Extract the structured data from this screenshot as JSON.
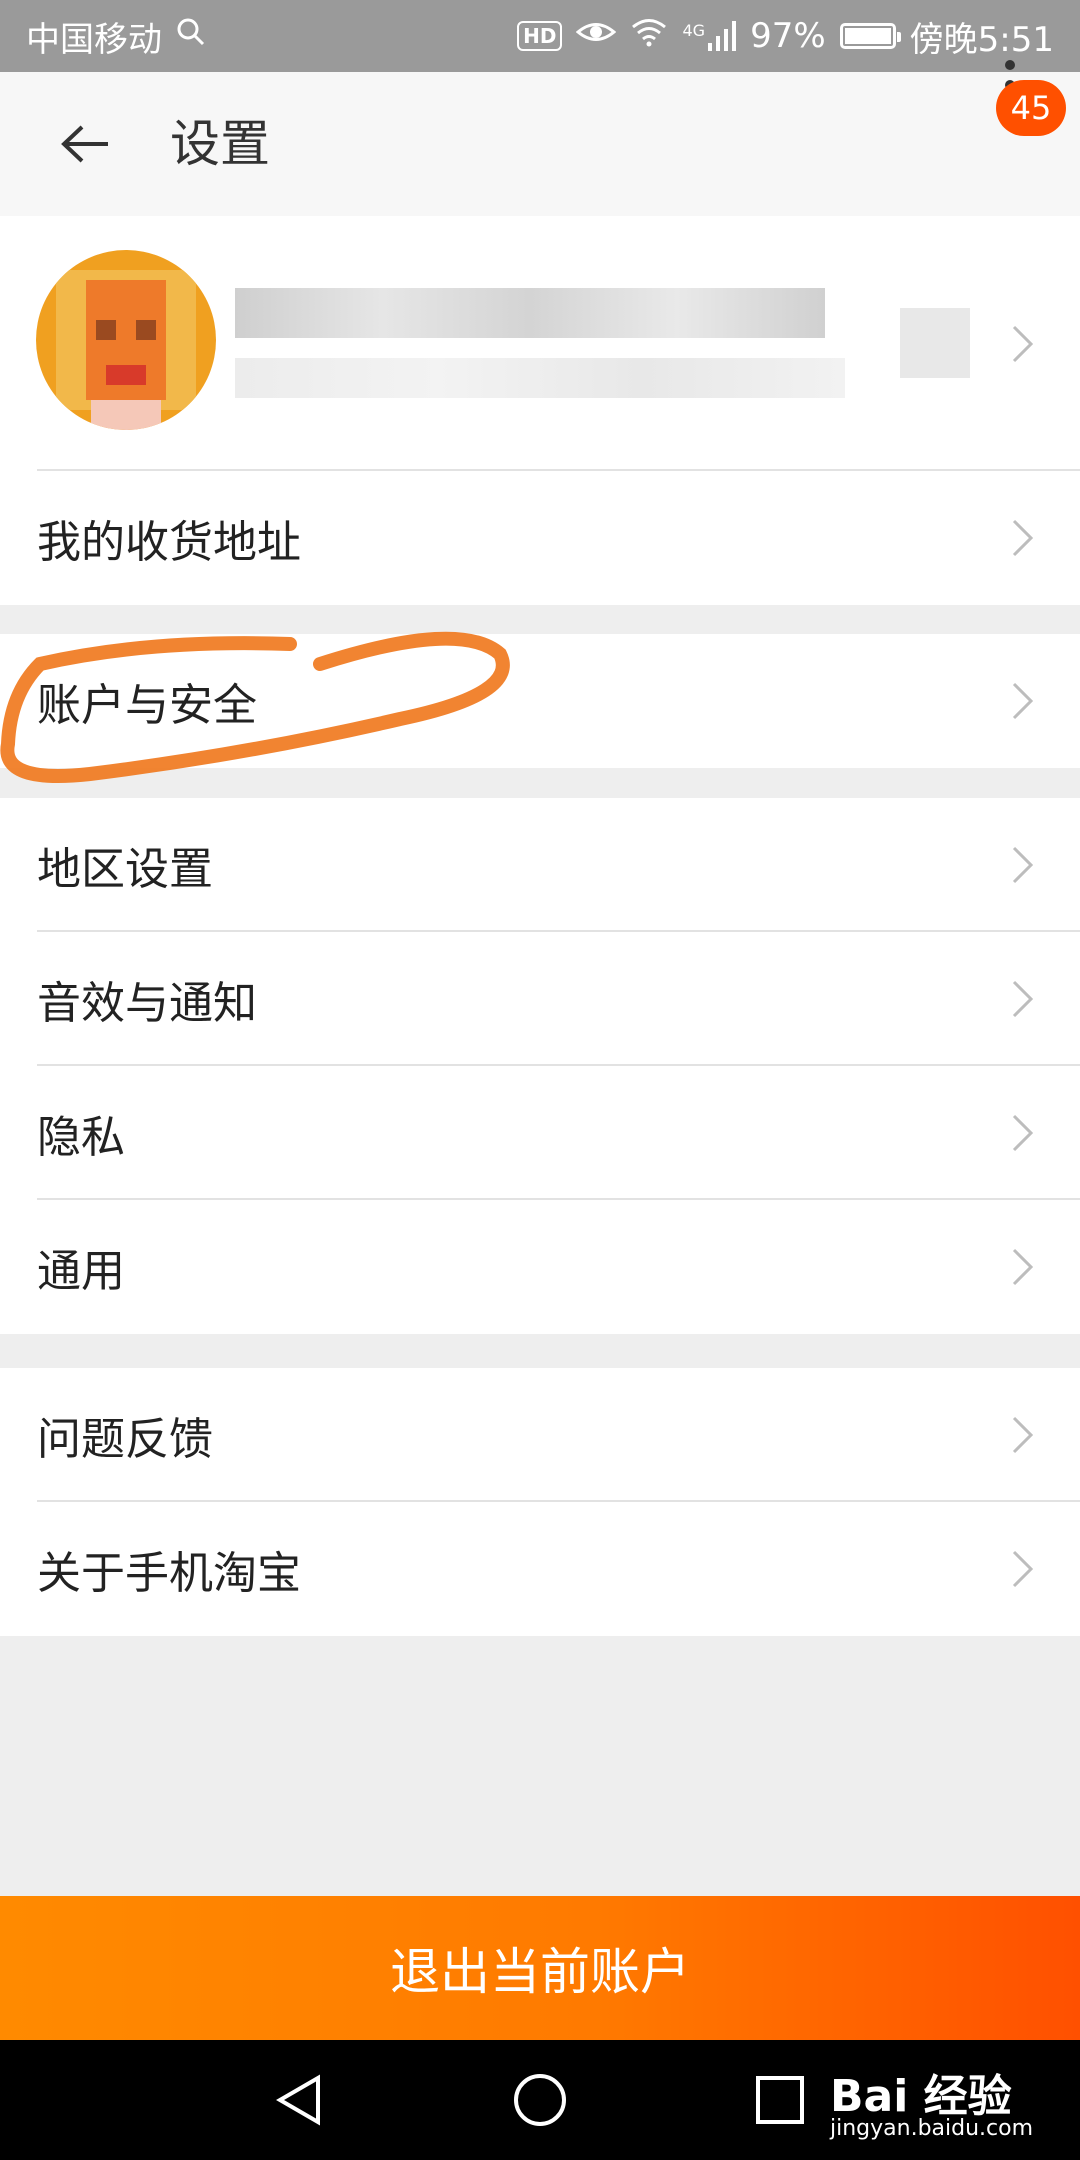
{
  "status_bar": {
    "carrier": "中国移动",
    "hd": "HD",
    "network": "4G",
    "battery": "97%",
    "time": "傍晚5:51"
  },
  "header": {
    "title": "设置",
    "badge_count": "45"
  },
  "menu": {
    "address": "我的收货地址",
    "account_security": "账户与安全",
    "region": "地区设置",
    "sound_notify": "音效与通知",
    "privacy": "隐私",
    "general": "通用",
    "feedback": "问题反馈",
    "about": "关于手机淘宝"
  },
  "logout_label": "退出当前账户",
  "watermark": {
    "brand": "Bai 经验",
    "url": "jingyan.baidu.com"
  },
  "colors": {
    "accent": "#ff5000",
    "highlight": "#f07a20"
  }
}
